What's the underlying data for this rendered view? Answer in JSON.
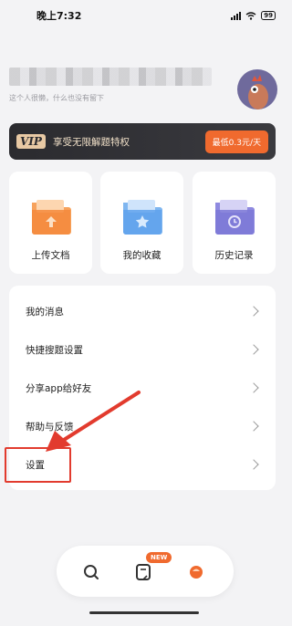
{
  "status_bar": {
    "time": "晚上7:32",
    "battery": "99"
  },
  "profile": {
    "bio": "这个人很懒，什么也没有留下"
  },
  "vip": {
    "badge": "VIP",
    "title": "享受无限解题特权",
    "price_label": "最低0.3元/天"
  },
  "quick_cards": [
    {
      "label": "上传文档",
      "icon": "upload-folder-icon"
    },
    {
      "label": "我的收藏",
      "icon": "favorites-folder-icon"
    },
    {
      "label": "历史记录",
      "icon": "history-folder-icon"
    }
  ],
  "menu": [
    {
      "label": "我的消息"
    },
    {
      "label": "快捷搜题设置"
    },
    {
      "label": "分享app给好友"
    },
    {
      "label": "帮助与反馈"
    },
    {
      "label": "设置"
    }
  ],
  "bottom_nav": {
    "new_badge": "NEW"
  },
  "colors": {
    "accent": "#f06a2e",
    "annotation": "#e23b2e",
    "vip_bg": "#2b2b2f"
  }
}
